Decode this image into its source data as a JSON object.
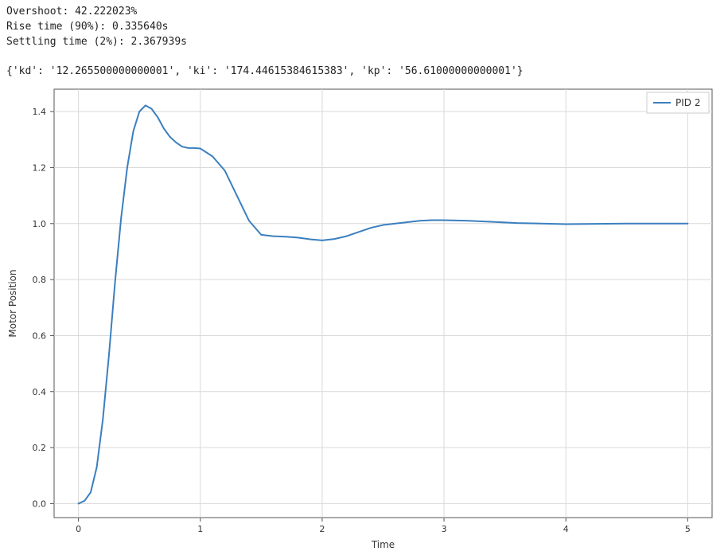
{
  "metrics": {
    "overshoot_line": "Overshoot: 42.222023%",
    "rise_line": "Rise time (90%): 0.335640s",
    "settling_line": "Settling time (2%): 2.367939s",
    "params_line": "{'kd': '12.265500000000001', 'ki': '174.44615384615383', 'kp': '56.61000000000001'}"
  },
  "chart_data": {
    "type": "line",
    "xlabel": "Time",
    "ylabel": "Motor Position",
    "xlim": [
      -0.2,
      5.2
    ],
    "ylim": [
      -0.05,
      1.48
    ],
    "xticks": [
      0,
      1,
      2,
      3,
      4,
      5
    ],
    "yticks": [
      0.0,
      0.2,
      0.4,
      0.6,
      0.8,
      1.0,
      1.2,
      1.4
    ],
    "legend": {
      "position": "upper-right",
      "entries": [
        "PID 2"
      ]
    },
    "series": [
      {
        "name": "PID 2",
        "color": "#3b7fbf",
        "x": [
          0.0,
          0.05,
          0.1,
          0.15,
          0.2,
          0.25,
          0.3,
          0.35,
          0.4,
          0.45,
          0.5,
          0.55,
          0.6,
          0.65,
          0.7,
          0.75,
          0.8,
          0.85,
          0.9,
          0.95,
          1.0,
          1.1,
          1.2,
          1.3,
          1.4,
          1.5,
          1.6,
          1.7,
          1.8,
          1.9,
          2.0,
          2.1,
          2.2,
          2.3,
          2.4,
          2.5,
          2.6,
          2.7,
          2.8,
          2.9,
          3.0,
          3.2,
          3.4,
          3.6,
          3.8,
          4.0,
          4.25,
          4.5,
          4.75,
          5.0
        ],
        "y": [
          0.0,
          0.01,
          0.04,
          0.13,
          0.3,
          0.53,
          0.79,
          1.02,
          1.2,
          1.33,
          1.4,
          1.422,
          1.41,
          1.38,
          1.34,
          1.31,
          1.29,
          1.275,
          1.27,
          1.27,
          1.268,
          1.24,
          1.19,
          1.1,
          1.01,
          0.96,
          0.955,
          0.953,
          0.95,
          0.944,
          0.94,
          0.945,
          0.955,
          0.97,
          0.985,
          0.995,
          1.0,
          1.005,
          1.01,
          1.012,
          1.012,
          1.01,
          1.006,
          1.002,
          1.0,
          0.998,
          0.999,
          1.0,
          1.0,
          1.0
        ]
      }
    ]
  }
}
